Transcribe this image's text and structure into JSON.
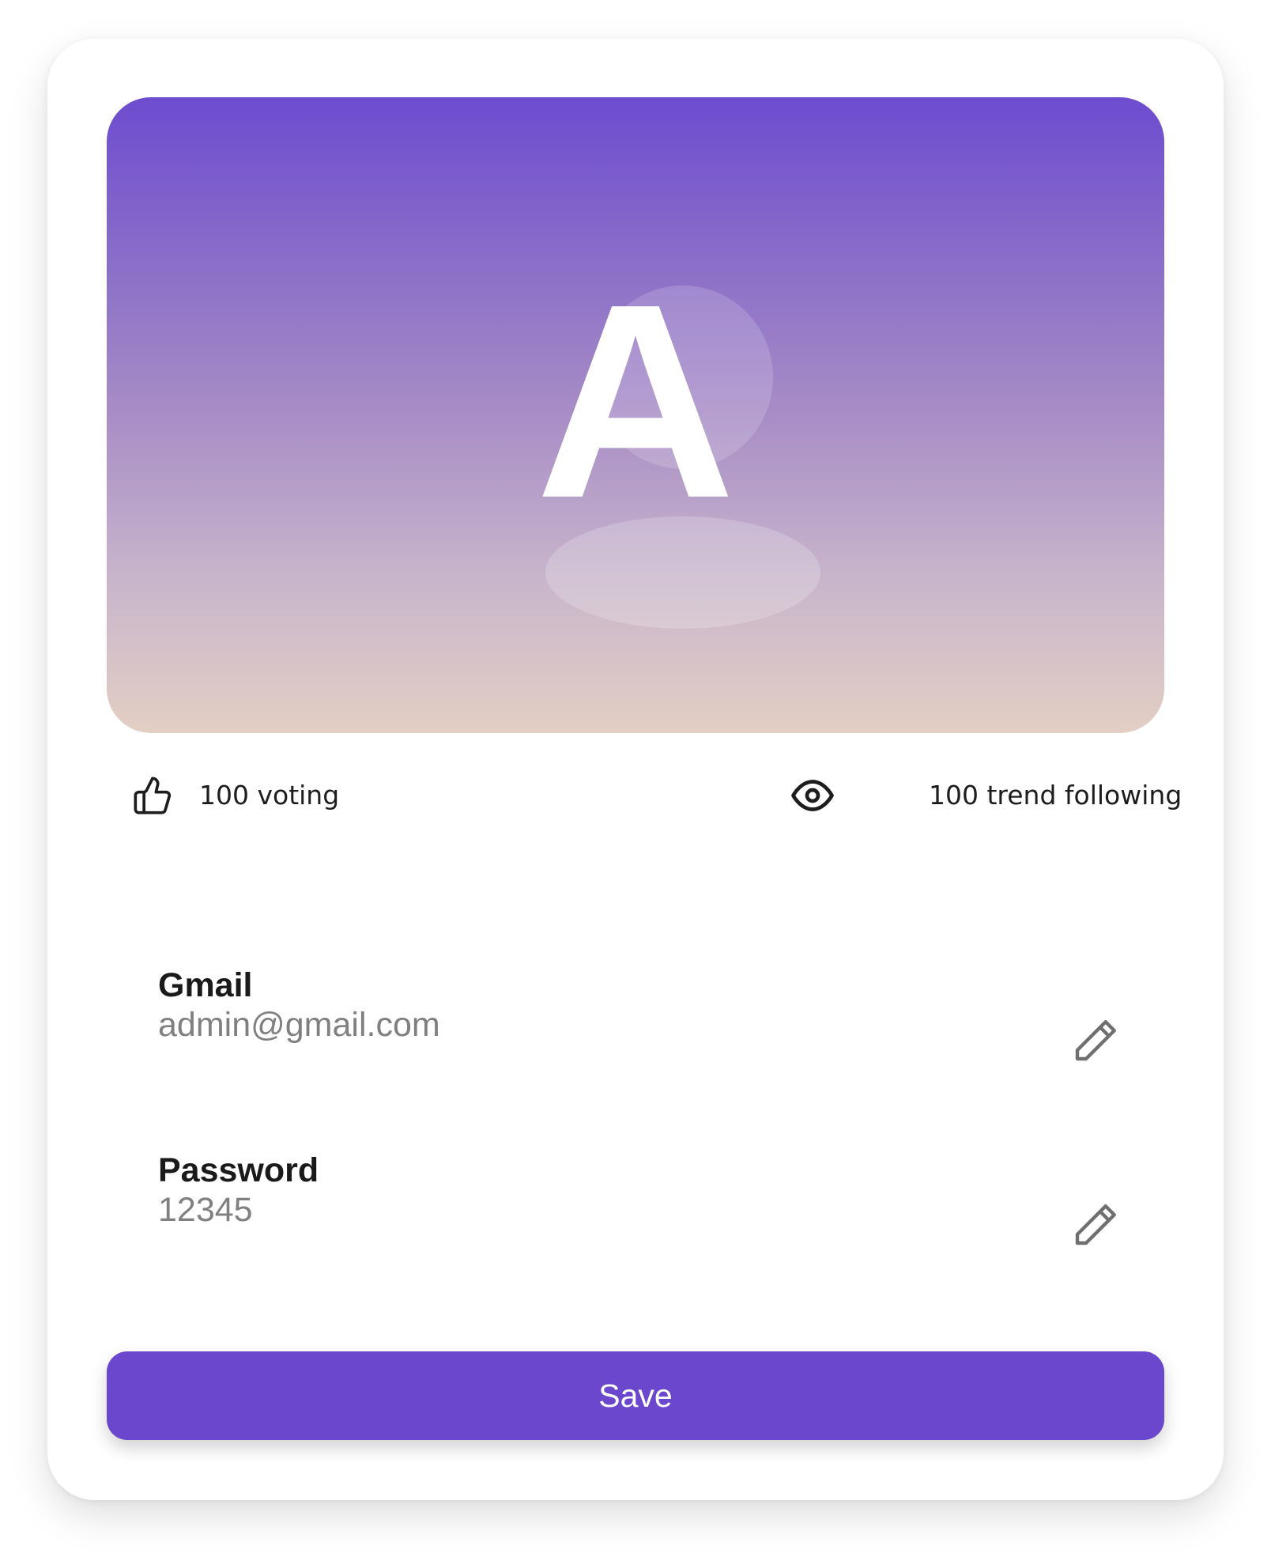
{
  "profile": {
    "avatar_initial": "A"
  },
  "stats": {
    "voting_label": "100 voting",
    "voting_icon": "thumbs-up-icon",
    "trend_label": "100 trend following",
    "trend_icon": "eye-icon"
  },
  "fields": {
    "email": {
      "label": "Gmail",
      "value": "admin@gmail.com",
      "icon": "pencil-icon"
    },
    "password": {
      "label": "Password",
      "value": "12345",
      "icon": "pencil-icon"
    }
  },
  "actions": {
    "save_label": "Save"
  },
  "colors": {
    "primary": "#6a47cd",
    "banner_top": "#6d4ccf",
    "banner_bottom": "#e3cfc3",
    "label_text": "#1a1a1a",
    "value_text": "#808080"
  }
}
